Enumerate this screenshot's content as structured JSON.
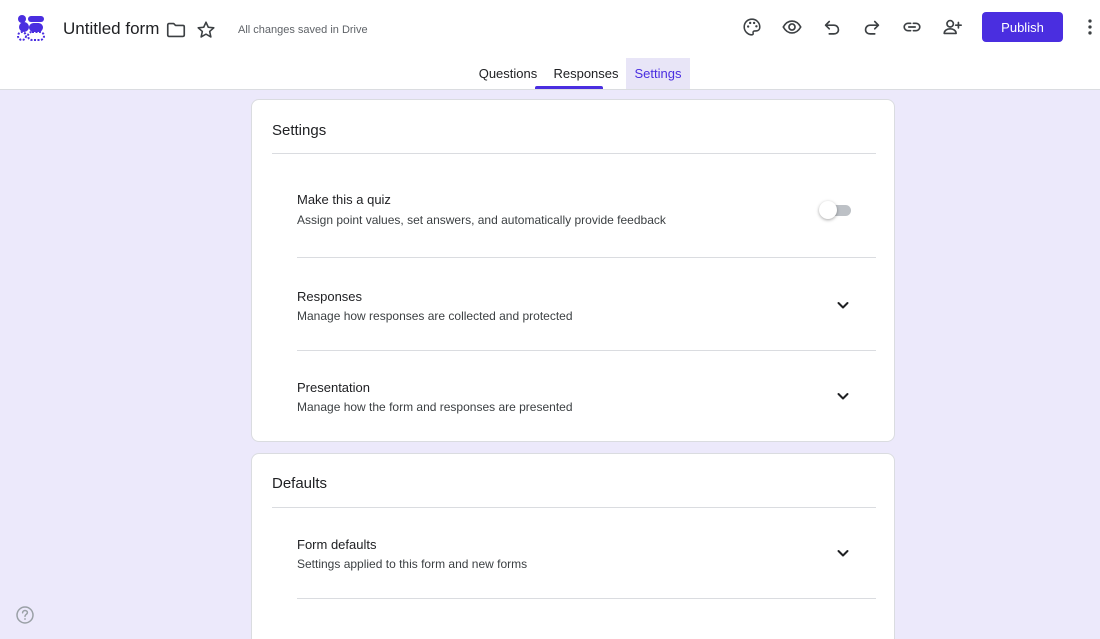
{
  "app": {
    "doc_title": "Untitled form",
    "save_status": "All changes saved in Drive",
    "accent_color": "#4a2ee0",
    "background_color": "#ece9fb"
  },
  "toolbar": {
    "icons": [
      "folder-icon",
      "star-icon",
      "palette-icon",
      "preview-icon",
      "undo-icon",
      "redo-icon",
      "link-icon",
      "add-collaborator-icon",
      "more-vert-icon"
    ],
    "publish_label": "Publish"
  },
  "tabs": [
    {
      "label": "Questions"
    },
    {
      "label": "Responses"
    },
    {
      "label": "Settings"
    }
  ],
  "settings_card": {
    "title": "Settings",
    "quiz": {
      "title": "Make this a quiz",
      "description": "Assign point values, set answers, and automatically provide feedback",
      "enabled": false
    },
    "sections": [
      {
        "title": "Responses",
        "description": "Manage how responses are collected and protected"
      },
      {
        "title": "Presentation",
        "description": "Manage how the form and responses are presented"
      }
    ]
  },
  "defaults_card": {
    "title": "Defaults",
    "sections": [
      {
        "title": "Form defaults",
        "description": "Settings applied to this form and new forms"
      }
    ]
  }
}
